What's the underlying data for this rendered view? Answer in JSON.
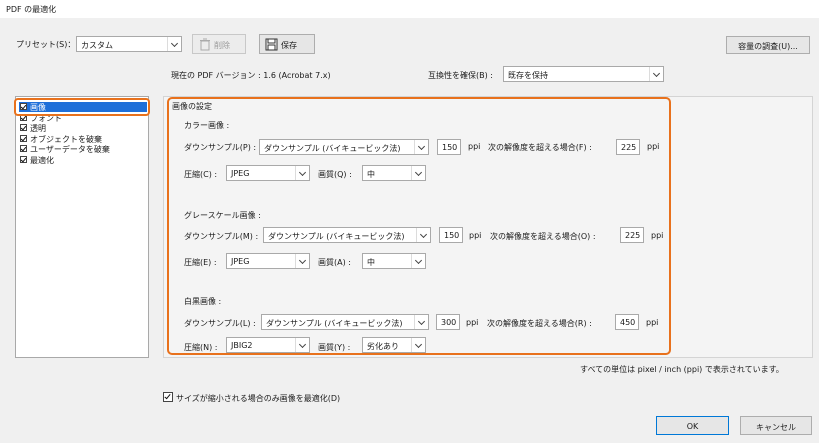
{
  "window": {
    "title": "PDF の最適化"
  },
  "toolbar": {
    "preset_label": "プリセット(S)：",
    "preset_value": "カスタム",
    "delete_label": "削除",
    "save_label": "保存",
    "audit_label": "容量の調査(U)..."
  },
  "version": {
    "text": "現在の PDF バージョン : 1.6 (Acrobat 7.x)",
    "compat_label": "互換性を確保(B) :",
    "compat_value": "既存を保持"
  },
  "sidebar": {
    "items": [
      {
        "label": "画像",
        "checked": true,
        "selected": true
      },
      {
        "label": "フォント",
        "checked": true,
        "selected": false
      },
      {
        "label": "透明",
        "checked": true,
        "selected": false
      },
      {
        "label": "オブジェクトを破棄",
        "checked": true,
        "selected": false
      },
      {
        "label": "ユーザーデータを破棄",
        "checked": true,
        "selected": false
      },
      {
        "label": "最適化",
        "checked": true,
        "selected": false
      }
    ]
  },
  "image_settings": {
    "title": "画像の設定",
    "color": {
      "heading": "カラー画像 :",
      "downsample_label": "ダウンサンプル(P) :",
      "downsample_value": "ダウンサンプル (バイキュービック法)",
      "ppi_value": "150",
      "ppi_unit": "ppi",
      "above_label": "次の解像度を超える場合(F) :",
      "above_value": "225",
      "above_unit": "ppi",
      "compress_label": "圧縮(C) :",
      "compress_value": "JPEG",
      "quality_label": "画質(Q) :",
      "quality_value": "中"
    },
    "gray": {
      "heading": "グレースケール画像 :",
      "downsample_label": "ダウンサンプル(M) :",
      "downsample_value": "ダウンサンプル (バイキュービック法)",
      "ppi_value": "150",
      "ppi_unit": "ppi",
      "above_label": "次の解像度を超える場合(O) :",
      "above_value": "225",
      "above_unit": "ppi",
      "compress_label": "圧縮(E) :",
      "compress_value": "JPEG",
      "quality_label": "画質(A) :",
      "quality_value": "中"
    },
    "mono": {
      "heading": "白黒画像 :",
      "downsample_label": "ダウンサンプル(L) :",
      "downsample_value": "ダウンサンプル (バイキュービック法)",
      "ppi_value": "300",
      "ppi_unit": "ppi",
      "above_label": "次の解像度を超える場合(R) :",
      "above_value": "450",
      "above_unit": "ppi",
      "compress_label": "圧縮(N) :",
      "compress_value": "JBIG2",
      "quality_label": "画質(Y) :",
      "quality_value": "劣化あり"
    },
    "units_note": "すべての単位は pixel / inch (ppi) で表示されています。"
  },
  "footer": {
    "optimize_label": "サイズが縮小される場合のみ画像を最適化(D)",
    "optimize_checked": true,
    "ok_label": "OK",
    "cancel_label": "キャンセル"
  },
  "colors": {
    "highlight": "#e8711c",
    "selection": "#1e6fd9",
    "ok_border": "#0078d7"
  }
}
